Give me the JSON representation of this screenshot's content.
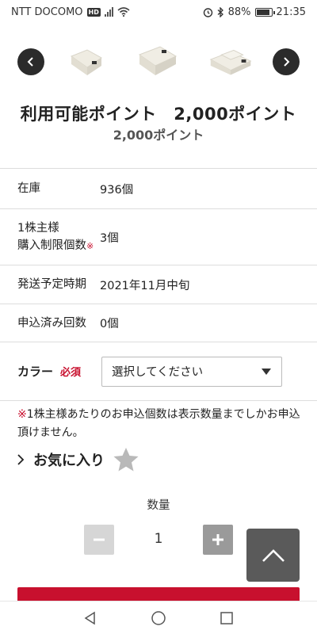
{
  "status_bar": {
    "carrier": "NTT DOCOMO",
    "hd_badge": "HD",
    "battery": "88%",
    "time": "21:35"
  },
  "carousel": {
    "prev_icon": "chevron-left-icon",
    "next_icon": "chevron-right-icon"
  },
  "points": {
    "title": "利用可能ポイント　2,000ポイント",
    "subtitle": "2,000ポイント"
  },
  "info": {
    "rows": [
      {
        "label": "在庫",
        "value": "936個"
      },
      {
        "label_line1": "1株主様",
        "label_line2": "購入制限個数",
        "label_mark": "※",
        "value": "3個"
      },
      {
        "label": "発送予定時期",
        "value": "2021年11月中旬"
      },
      {
        "label": "申込済み回数",
        "value": "0個"
      }
    ]
  },
  "color": {
    "label": "カラー",
    "required": "必須",
    "select_value": "選択してください"
  },
  "notice": {
    "mark": "※",
    "text": "1株主様あたりのお申込個数は表示数量までしかお申込頂けません。"
  },
  "favorite": {
    "label": "お気に入り"
  },
  "quantity": {
    "label": "数量",
    "value": "1"
  },
  "colors": {
    "accent": "#c8102e",
    "dark_button": "#2b2b2b",
    "to_top": "#5a5a5a"
  }
}
